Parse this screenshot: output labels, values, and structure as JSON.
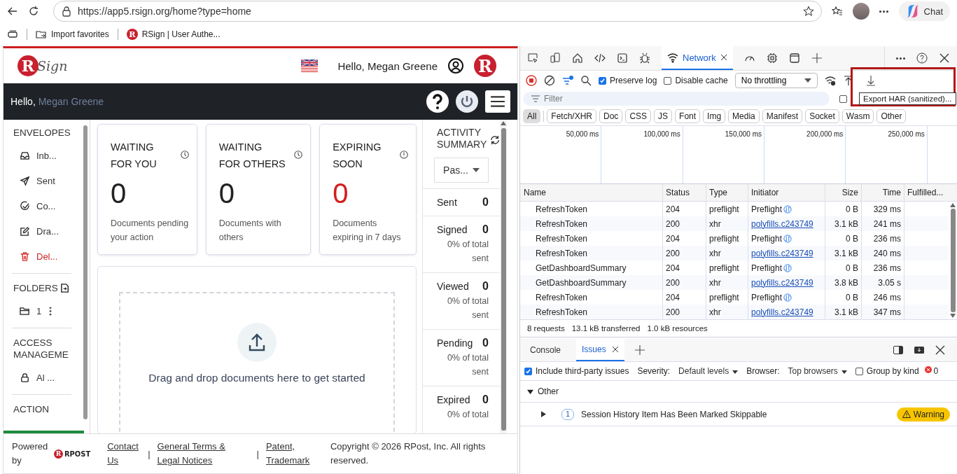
{
  "browser": {
    "url": "https://app5.rsign.org/home?type=home",
    "chat": "Chat"
  },
  "bookmarks": [
    {
      "label": "Import favorites"
    },
    {
      "label": "RSign | User Authe...",
      "mark": "R"
    }
  ],
  "app": {
    "logo_mark": "R",
    "logo_word": "Sign",
    "greeting": "Hello, Megan Greene",
    "brand_mark": "R",
    "bar_hello": "Hello,",
    "bar_name": "Megan Greene",
    "sidebar": [
      {
        "title": "ENVELOPES",
        "action": false,
        "items": [
          {
            "label": "Inb...",
            "kind": "inbox",
            "danger": false
          },
          {
            "label": "Sent",
            "kind": "send",
            "danger": false
          },
          {
            "label": "Co...",
            "kind": "check",
            "danger": false
          },
          {
            "label": "Dra...",
            "kind": "edit",
            "danger": false
          },
          {
            "label": "Del...",
            "kind": "trash",
            "danger": true
          }
        ]
      },
      {
        "title": "FOLDERS",
        "action": true,
        "items": [
          {
            "label": "1",
            "kind": "folder",
            "danger": false
          }
        ]
      },
      {
        "title": "ACCESS MANAGEME",
        "action": false,
        "items": [
          {
            "label": "Al ...",
            "kind": "lock",
            "danger": false
          }
        ]
      },
      {
        "title": "ACTION",
        "action": false
      }
    ],
    "cards": [
      {
        "title_lines": [
          "WAITING",
          "FOR YOU"
        ],
        "kind": "clock",
        "count": "0",
        "text": "Documents pending your action",
        "alert": false
      },
      {
        "title_lines": [
          "WAITING",
          "FOR OTHERS"
        ],
        "kind": "clock",
        "count": "0",
        "text": "Documents with others",
        "alert": false
      },
      {
        "title_lines": [
          "EXPIRING",
          "SOON"
        ],
        "kind": "alert",
        "count": "0",
        "text": "Documents expiring in 7 days",
        "alert": true
      }
    ],
    "dropzone": "Drag and drop documents here to get started",
    "activity": {
      "title": "ACTIVITY SUMMARY",
      "period": "Pas...",
      "rows": [
        {
          "label": "Sent",
          "count": "0"
        },
        {
          "label": "Signed",
          "count": "0",
          "note": "0% of total sent"
        },
        {
          "label": "Viewed",
          "count": "0",
          "note": "0% of total sent"
        },
        {
          "label": "Pending",
          "count": "0",
          "note": "0% of total sent"
        },
        {
          "label": "Expired",
          "count": "0",
          "note": "0% of total"
        }
      ]
    },
    "footer": {
      "powered": "Powered by",
      "logo_mark": "R",
      "logo_word": "RPOST",
      "links": [
        "Contact Us",
        "General Terms & Legal Notices",
        "Patent, Trademark"
      ],
      "separator": "|",
      "copyright": "Copyright © 2026 RPost, Inc. All rights reserved."
    }
  },
  "devtools": {
    "panel": "Network",
    "preserve_log": true,
    "disable_cache": false,
    "preserve_label": "Preserve log",
    "cache_label": "Disable cache",
    "throttling": "No throttling",
    "tooltip": "Export HAR (sanitized)...",
    "filter_placeholder": "Filter",
    "filter_option": false,
    "types": [
      {
        "label": "All",
        "selected": true
      },
      {
        "label": "Fetch/XHR",
        "selected": false
      },
      {
        "label": "Doc",
        "selected": false
      },
      {
        "label": "CSS",
        "selected": false
      },
      {
        "label": "JS",
        "selected": false
      },
      {
        "label": "Font",
        "selected": false
      },
      {
        "label": "Img",
        "selected": false
      },
      {
        "label": "Media",
        "selected": false
      },
      {
        "label": "Manifest",
        "selected": false
      },
      {
        "label": "Socket",
        "selected": false
      },
      {
        "label": "Wasm",
        "selected": false
      },
      {
        "label": "Other",
        "selected": false
      }
    ],
    "ticks": [
      "50,000 ms",
      "100,000 ms",
      "150,000 ms",
      "200,000 ms",
      "250,000 ms"
    ],
    "columns": [
      "Name",
      "Status",
      "Type",
      "Initiator",
      "Size",
      "Time",
      "Fulfilled..."
    ],
    "rows": [
      {
        "name": "RefreshToken",
        "status": "204",
        "type": "preflight",
        "initiator": "Preflight",
        "link": false,
        "size": "0 B",
        "time": "329 ms"
      },
      {
        "name": "RefreshToken",
        "status": "200",
        "type": "xhr",
        "initiator": "polyfills.c243749",
        "link": true,
        "size": "3.1 kB",
        "time": "241 ms"
      },
      {
        "name": "RefreshToken",
        "status": "204",
        "type": "preflight",
        "initiator": "Preflight",
        "link": false,
        "size": "0 B",
        "time": "236 ms"
      },
      {
        "name": "RefreshToken",
        "status": "200",
        "type": "xhr",
        "initiator": "polyfills.c243749",
        "link": true,
        "size": "3.1 kB",
        "time": "240 ms"
      },
      {
        "name": "GetDashboardSummary",
        "status": "204",
        "type": "preflight",
        "initiator": "Preflight",
        "link": false,
        "size": "0 B",
        "time": "236 ms"
      },
      {
        "name": "GetDashboardSummary",
        "status": "200",
        "type": "xhr",
        "initiator": "polyfills.c243749",
        "link": true,
        "size": "3.8 kB",
        "time": "3.05 s"
      },
      {
        "name": "RefreshToken",
        "status": "204",
        "type": "preflight",
        "initiator": "Preflight",
        "link": false,
        "size": "0 B",
        "time": "246 ms"
      },
      {
        "name": "RefreshToken",
        "status": "200",
        "type": "xhr",
        "initiator": "polyfills.c243749",
        "link": true,
        "size": "3.1 kB",
        "time": "347 ms"
      }
    ],
    "summary": [
      "8 requests",
      "13.1 kB transferred",
      "1.0 kB resources"
    ],
    "drawer_tabs": [
      {
        "label": "Console",
        "selected": false
      },
      {
        "label": "Issues",
        "selected": true
      }
    ],
    "third_party": true,
    "third_party_label": "Include third-party issues",
    "severity_label": "Severity:",
    "severity": "Default levels",
    "browser_label": "Browser:",
    "browser": "Top browsers",
    "group_by_kind": false,
    "group_label": "Group by kind",
    "errors": "0",
    "group": {
      "label": "Other",
      "expanded": true,
      "issues": [
        {
          "count": "1",
          "text": "Session History Item Has Been Marked Skippable",
          "severity": "Warning"
        }
      ]
    }
  }
}
